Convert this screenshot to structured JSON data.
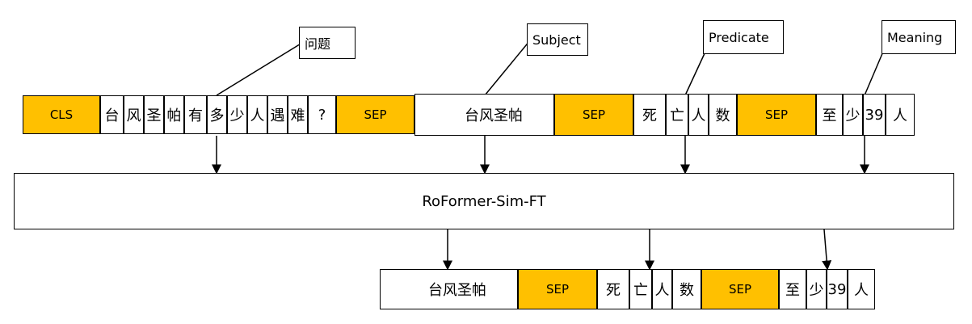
{
  "labels": {
    "question": "问题",
    "subject": "Subject",
    "predicate": "Predicate",
    "meaning": "Meaning"
  },
  "model": "RoFormer-Sim-FT",
  "input_row": [
    "CLS",
    "台",
    "风",
    "圣",
    "帕",
    "有",
    "多",
    "少",
    "人",
    "遇",
    "难",
    "?",
    "SEP",
    "台风圣帕",
    "SEP",
    "死",
    "亡",
    "人",
    "数",
    "SEP",
    "至",
    "少",
    "39",
    "人"
  ],
  "output_row": [
    "台风圣帕",
    "SEP",
    "死",
    "亡",
    "人",
    "数",
    "SEP",
    "至",
    "少",
    "39",
    "人"
  ],
  "colors": {
    "sep": "#FFC000",
    "border": "#000000",
    "background": "#ffffff"
  }
}
